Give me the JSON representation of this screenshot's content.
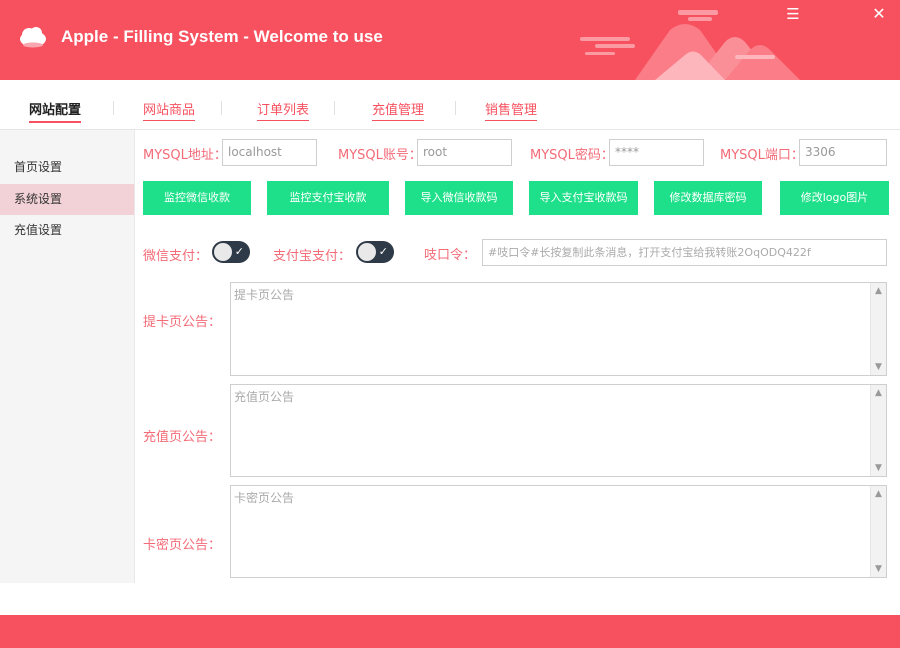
{
  "app": {
    "title": "Apple - Filling System - Welcome to use",
    "logo_icon": "cloud-icon",
    "accent_color": "#f7515f",
    "button_color": "#1fe08a"
  },
  "window": {
    "minimize_icon": "menu-icon",
    "close_icon": "close-icon",
    "minimize_glyph": "☰",
    "close_glyph": "✕"
  },
  "tabs": [
    {
      "label": "网站配置",
      "active": true
    },
    {
      "label": "网站商品"
    },
    {
      "label": "订单列表"
    },
    {
      "label": "充值管理"
    },
    {
      "label": "销售管理"
    }
  ],
  "sidebar": {
    "items": [
      {
        "label": "首页设置"
      },
      {
        "label": "系统设置",
        "active": true
      },
      {
        "label": "充值设置"
      }
    ]
  },
  "mysql": {
    "address_label": "MYSQL地址：",
    "address_value": "localhost",
    "account_label": "MYSQL账号：",
    "account_value": "root",
    "password_label": "MYSQL密码：",
    "password_value": "****",
    "port_label": "MYSQL端口：",
    "port_value": "3306"
  },
  "buttons": [
    {
      "label": "监控微信收款"
    },
    {
      "label": "监控支付宝收款"
    },
    {
      "label": "导入微信收款码"
    },
    {
      "label": "导入支付宝收款码"
    },
    {
      "label": "修改数据库密码"
    },
    {
      "label": "修改logo图片"
    }
  ],
  "payment": {
    "wechat_label": "微信支付：",
    "wechat_enabled": true,
    "alipay_label": "支付宝支付：",
    "alipay_enabled": true,
    "check_glyph": "✓",
    "password_cmd_label": "吱口令：",
    "password_cmd_placeholder": "#吱口令#长按复制此条消息，打开支付宝给我转账2OqODQ422f"
  },
  "notices": {
    "card_label": "提卡页公告：",
    "card_placeholder": "提卡页公告",
    "recharge_label": "充值页公告：",
    "recharge_placeholder": "充值页公告",
    "secret_label": "卡密页公告：",
    "secret_placeholder": "卡密页公告",
    "scroll_up_glyph": "▲",
    "scroll_down_glyph": "▼"
  }
}
